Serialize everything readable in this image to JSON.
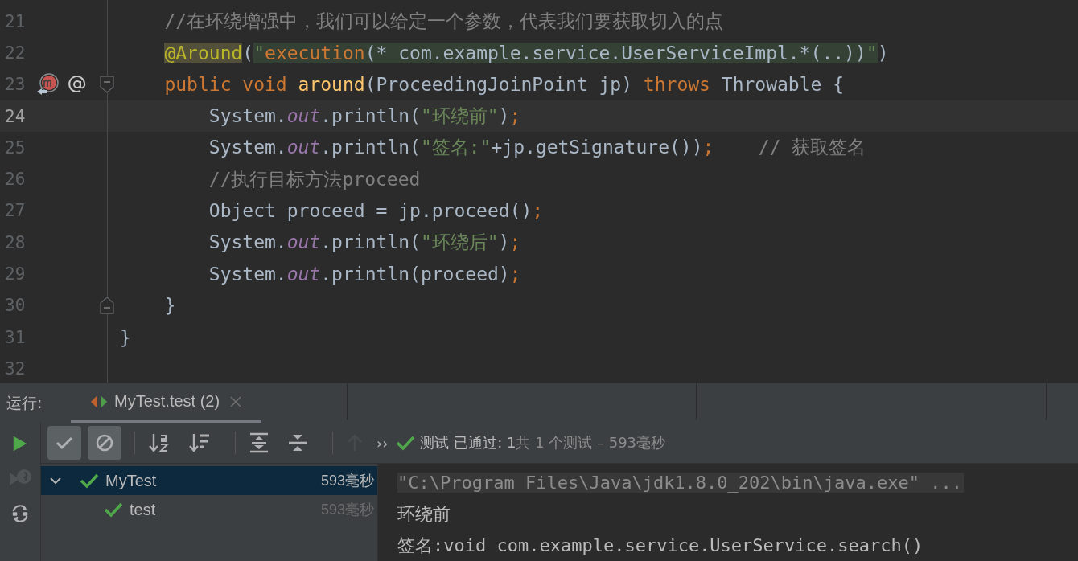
{
  "editor": {
    "lines": [
      {
        "number": "21",
        "current": false,
        "fold_start": false,
        "fold_end": false,
        "gutter_marks": false,
        "tokens": [
          {
            "text": "    //在环绕增强中，我们可以给定一个参数，代表我们要获取切入的点",
            "kind": "comment"
          }
        ]
      },
      {
        "number": "22",
        "current": false,
        "fold_start": false,
        "fold_end": false,
        "gutter_marks": false,
        "tokens": [
          {
            "text": "    @Around",
            "kind": "annotation-usage"
          },
          {
            "text": "(",
            "kind": "plain"
          },
          {
            "text": "\"",
            "kind": "injected-string"
          },
          {
            "text": "execution",
            "kind": "injected-keyword"
          },
          {
            "text": "(* com.example.service.UserServiceImpl.*(..))",
            "kind": "injected-plain"
          },
          {
            "text": "\"",
            "kind": "injected-string"
          },
          {
            "text": ")",
            "kind": "plain"
          }
        ]
      },
      {
        "number": "23",
        "current": false,
        "fold_start": true,
        "fold_end": false,
        "gutter_marks": true,
        "tokens": [
          {
            "text": "    public void ",
            "kind": "keyword"
          },
          {
            "text": "around",
            "kind": "method"
          },
          {
            "text": "(ProceedingJoinPoint jp) ",
            "kind": "plain"
          },
          {
            "text": "throws ",
            "kind": "keyword"
          },
          {
            "text": "Throwable {",
            "kind": "plain"
          }
        ]
      },
      {
        "number": "24",
        "current": true,
        "fold_start": false,
        "fold_end": false,
        "gutter_marks": false,
        "tokens": [
          {
            "text": "        System.",
            "kind": "plain"
          },
          {
            "text": "out",
            "kind": "field"
          },
          {
            "text": ".println(",
            "kind": "plain"
          },
          {
            "text": "\"环绕前\"",
            "kind": "string"
          },
          {
            "text": ")",
            "kind": "plain"
          },
          {
            "text": ";",
            "kind": "keyword"
          }
        ]
      },
      {
        "number": "25",
        "current": false,
        "fold_start": false,
        "fold_end": false,
        "gutter_marks": false,
        "tokens": [
          {
            "text": "        System.",
            "kind": "plain"
          },
          {
            "text": "out",
            "kind": "field"
          },
          {
            "text": ".println(",
            "kind": "plain"
          },
          {
            "text": "\"签名:\"",
            "kind": "string"
          },
          {
            "text": "+jp.getSignature())",
            "kind": "plain"
          },
          {
            "text": ";",
            "kind": "keyword"
          },
          {
            "text": "    // 获取签名",
            "kind": "comment"
          }
        ]
      },
      {
        "number": "26",
        "current": false,
        "fold_start": false,
        "fold_end": false,
        "gutter_marks": false,
        "tokens": [
          {
            "text": "        //执行目标方法proceed",
            "kind": "comment"
          }
        ]
      },
      {
        "number": "27",
        "current": false,
        "fold_start": false,
        "fold_end": false,
        "gutter_marks": false,
        "tokens": [
          {
            "text": "        Object proceed = jp.proceed()",
            "kind": "plain"
          },
          {
            "text": ";",
            "kind": "keyword"
          }
        ]
      },
      {
        "number": "28",
        "current": false,
        "fold_start": false,
        "fold_end": false,
        "gutter_marks": false,
        "tokens": [
          {
            "text": "        System.",
            "kind": "plain"
          },
          {
            "text": "out",
            "kind": "field"
          },
          {
            "text": ".println(",
            "kind": "plain"
          },
          {
            "text": "\"环绕后\"",
            "kind": "string"
          },
          {
            "text": ")",
            "kind": "plain"
          },
          {
            "text": ";",
            "kind": "keyword"
          }
        ]
      },
      {
        "number": "29",
        "current": false,
        "fold_start": false,
        "fold_end": false,
        "gutter_marks": false,
        "tokens": [
          {
            "text": "        System.",
            "kind": "plain"
          },
          {
            "text": "out",
            "kind": "field"
          },
          {
            "text": ".println(proceed)",
            "kind": "plain"
          },
          {
            "text": ";",
            "kind": "keyword"
          }
        ]
      },
      {
        "number": "30",
        "current": false,
        "fold_start": false,
        "fold_end": true,
        "gutter_marks": false,
        "tokens": [
          {
            "text": "    }",
            "kind": "plain"
          }
        ]
      },
      {
        "number": "31",
        "current": false,
        "fold_start": false,
        "fold_end": false,
        "gutter_marks": false,
        "tokens": [
          {
            "text": "}",
            "kind": "plain"
          }
        ]
      },
      {
        "number": "32",
        "current": false,
        "fold_start": false,
        "fold_end": false,
        "gutter_marks": false
      }
    ]
  },
  "run_panel": {
    "label": "运行:",
    "tabs": [
      {
        "label": "MyTest.test (2)",
        "selected": true
      }
    ],
    "side_actions": [
      {
        "kind": "rerun",
        "disabled": false
      },
      {
        "kind": "rerun-failed",
        "disabled": true
      },
      {
        "kind": "auto-test",
        "disabled": false
      }
    ],
    "toggles": [
      {
        "kind": "show-passed",
        "on": true
      },
      {
        "kind": "show-ignored",
        "on": true
      }
    ],
    "actions": [
      {
        "kind": "sort-alpha",
        "disabled": false
      },
      {
        "kind": "sort-duration",
        "disabled": false
      },
      {
        "kind": "expand-all",
        "disabled": false
      },
      {
        "kind": "collapse-all",
        "disabled": false
      },
      {
        "kind": "previous",
        "disabled": true
      }
    ],
    "more": "››",
    "status": {
      "passed": "测试 已通过: 1",
      "summary": "共 1 个测试 – 593毫秒"
    },
    "tree": [
      {
        "name": "MyTest",
        "time": "593毫秒",
        "selected": true,
        "expanded": true,
        "children": [
          {
            "name": "test",
            "time": "593毫秒",
            "selected": false
          }
        ]
      }
    ],
    "console": [
      {
        "text": "\"C:\\Program Files\\Java\\jdk1.8.0_202\\bin\\java.exe\" ...",
        "kind": "command"
      },
      {
        "text": "环绕前",
        "kind": "output"
      },
      {
        "text": "签名:void com.example.service.UserService.search()",
        "kind": "output"
      }
    ]
  }
}
